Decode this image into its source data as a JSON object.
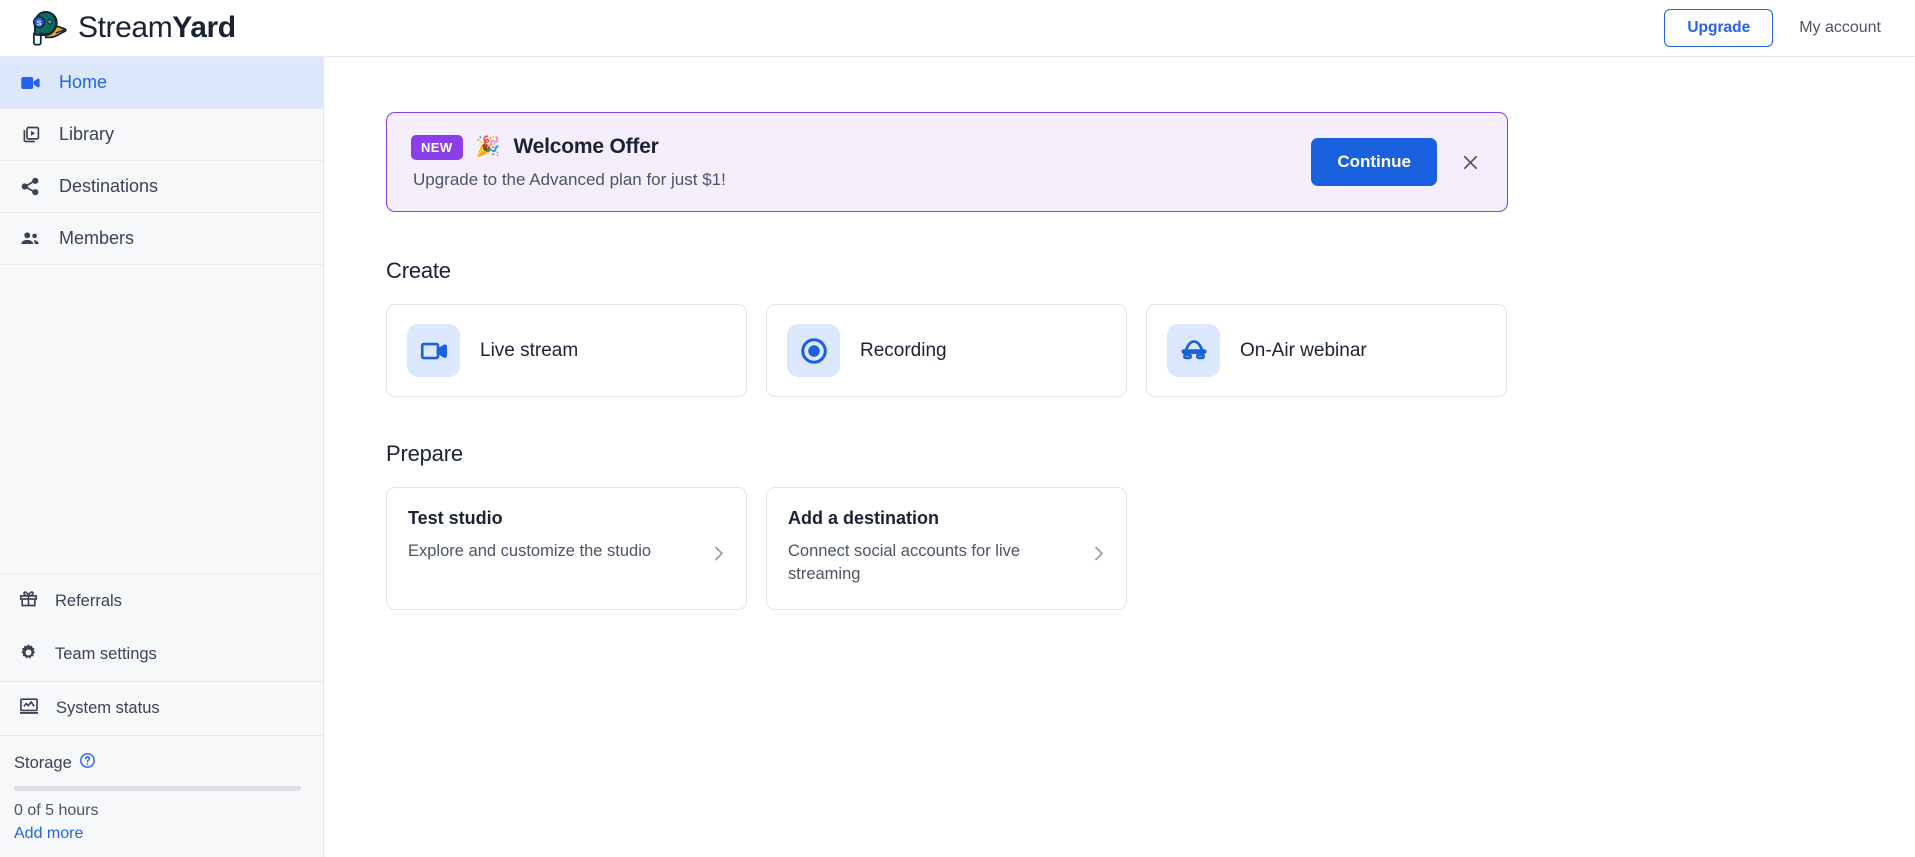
{
  "topbar": {
    "brand_light": "Stream",
    "brand_bold": "Yard",
    "upgrade_label": "Upgrade",
    "account_label": "My account"
  },
  "sidebar": {
    "primary_items": [
      {
        "label": "Home",
        "icon": "video-camera-icon",
        "active": true
      },
      {
        "label": "Library",
        "icon": "library-icon",
        "active": false
      },
      {
        "label": "Destinations",
        "icon": "share-icon",
        "active": false
      },
      {
        "label": "Members",
        "icon": "people-icon",
        "active": false
      }
    ],
    "secondary_items": [
      {
        "label": "Referrals",
        "icon": "gift-icon"
      },
      {
        "label": "Team settings",
        "icon": "gear-icon"
      },
      {
        "label": "System status",
        "icon": "monitor-chart-icon"
      }
    ],
    "storage": {
      "label": "Storage",
      "help_icon": "help-circle-icon",
      "amount": "0 of 5 hours",
      "add_more": "Add more",
      "percent_used": 0
    }
  },
  "banner": {
    "badge": "NEW",
    "emoji": "🎉",
    "title": "Welcome Offer",
    "subtitle": "Upgrade to the Advanced plan for just $1!",
    "continue_label": "Continue",
    "close_icon": "close-icon",
    "accent_color": "#8b3fe8",
    "background_color": "#f4eefd"
  },
  "create": {
    "section_title": "Create",
    "cards": [
      {
        "label": "Live stream",
        "icon": "video-camera-icon"
      },
      {
        "label": "Recording",
        "icon": "record-circle-icon"
      },
      {
        "label": "On-Air webinar",
        "icon": "webinar-icon"
      }
    ]
  },
  "prepare": {
    "section_title": "Prepare",
    "cards": [
      {
        "title": "Test studio",
        "description": "Explore and customize the studio",
        "chevron": "chevron-right-icon"
      },
      {
        "title": "Add a destination",
        "description": "Connect social accounts for live streaming",
        "chevron": "chevron-right-icon"
      }
    ]
  },
  "colors": {
    "accent_blue": "#2563eb",
    "button_blue": "#1a61e0",
    "purple": "#8b3fe8",
    "sidebar_bg": "#f7f8fa",
    "active_nav_bg": "#dde8fd"
  }
}
